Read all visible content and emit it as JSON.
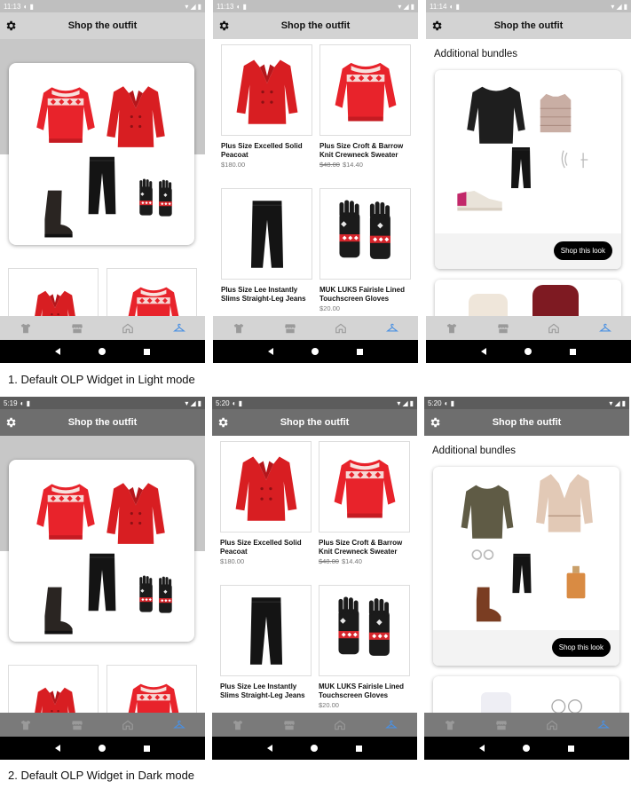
{
  "screens": {
    "light": {
      "outfit": {
        "time": "11:13",
        "title": "Shop the outfit"
      },
      "products": {
        "time": "11:13",
        "title": "Shop the outfit"
      },
      "bundles": {
        "time": "11:14",
        "title": "Shop the outfit"
      }
    },
    "dark": {
      "outfit": {
        "time": "5:19",
        "title": "Shop the outfit"
      },
      "products": {
        "time": "5:20",
        "title": "Shop the outfit"
      },
      "bundles": {
        "time": "5:20",
        "title": "Shop the outfit"
      }
    }
  },
  "products": [
    {
      "name": "Plus Size Excelled Solid Peacoat",
      "old_price": "",
      "price": "$180.00"
    },
    {
      "name": "Plus Size Croft & Barrow Knit Crewneck Sweater",
      "old_price": "$48.00",
      "price": "$14.40"
    },
    {
      "name": "Plus Size Lee Instantly Slims Straight-Leg Jeans",
      "old_price": "",
      "price": ""
    },
    {
      "name": "MUK LUKS Fairisle Lined Touchscreen Gloves",
      "old_price": "",
      "price": "$20.00"
    }
  ],
  "bundles": {
    "heading": "Additional bundles",
    "cta": "Shop this look"
  },
  "captions": {
    "light": "1. Default OLP Widget in Light mode",
    "dark": "2. Default OLP Widget in Dark mode"
  },
  "icons": {
    "settings": "gear-icon",
    "nav": [
      "shirt-icon",
      "store-icon",
      "home-icon",
      "hanger-icon"
    ]
  },
  "colors": {
    "accent": "#4a90e2",
    "sweater_red": "#e8232b",
    "coat_red": "#d81e22",
    "cta_black": "#000000"
  }
}
